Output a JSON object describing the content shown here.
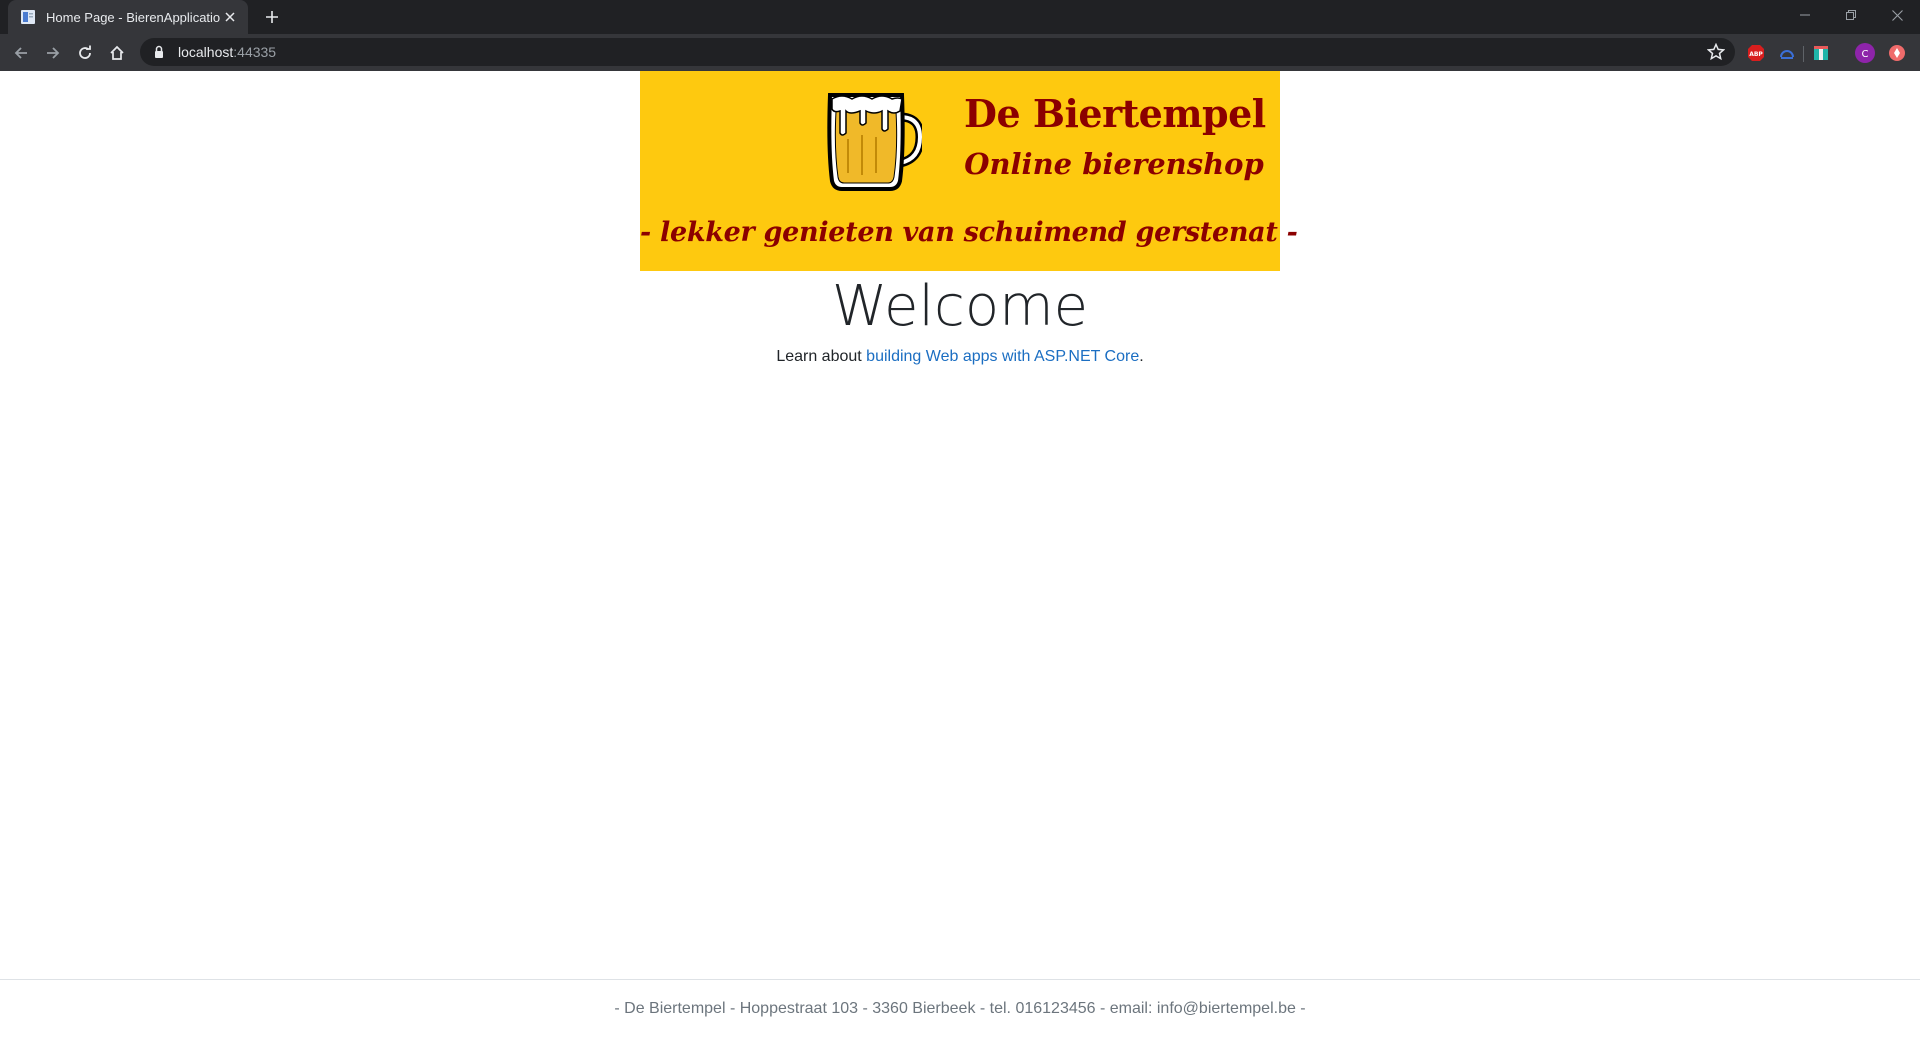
{
  "browser": {
    "tab_title": "Home Page - BierenApplication",
    "url_host": "localhost",
    "url_port": ":44335",
    "extensions": [
      "adblock-plus-icon",
      "extension-icon",
      "extension-icon-2",
      "profile-avatar",
      "extension-icon-3"
    ],
    "profile_initial": "C",
    "abp_label": "ABP"
  },
  "banner": {
    "title": "De Biertempel",
    "subtitle": "Online bierenshop",
    "tagline": "- lekker genieten van schuimend gerstenat -"
  },
  "main": {
    "heading": "Welcome",
    "learn_prefix": "Learn about ",
    "learn_link": "building Web apps with ASP.NET Core",
    "learn_suffix": "."
  },
  "footer": {
    "text": "- De Biertempel - Hoppestraat 103 - 3360 Bierbeek - tel. 016123456 - email: info@biertempel.be -"
  },
  "colors": {
    "banner_bg": "#fec90f",
    "brand_red": "#8b0000",
    "link": "#1b6ec2"
  }
}
